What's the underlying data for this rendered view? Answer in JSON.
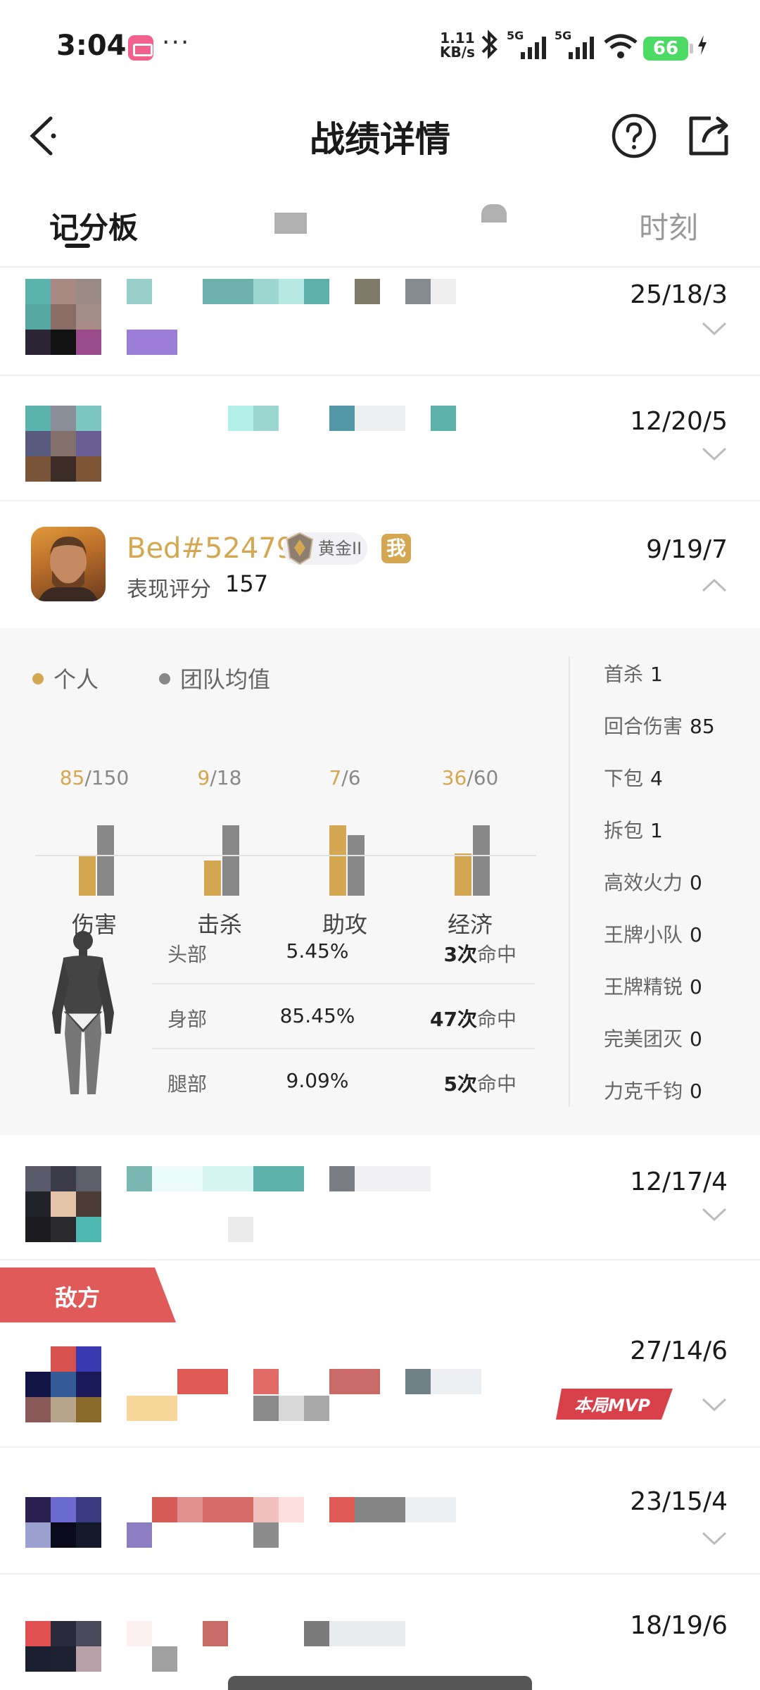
{
  "status_bar": {
    "time": "3:04",
    "network_speed": "1.11",
    "network_unit": "KB/s",
    "signal_1": "5G",
    "signal_2": "5G",
    "battery": "66",
    "more": "···"
  },
  "header": {
    "title": "战绩详情",
    "back_icon": "back-arrow-icon",
    "help_icon": "question-circle-icon",
    "share_icon": "share-icon"
  },
  "tabs": {
    "items": [
      {
        "label": "记分板",
        "active": true
      },
      {
        "label": "",
        "active": false
      },
      {
        "label": "",
        "active": false
      },
      {
        "label": "时刻",
        "active": false
      }
    ]
  },
  "rows_top": [
    {
      "kda": "25/18/3"
    },
    {
      "kda": "12/20/5"
    }
  ],
  "player": {
    "name": "Bed#52479",
    "rank": "黄金II",
    "me_badge": "我",
    "score_label": "表现评分",
    "score": "157",
    "kda": "9/19/7"
  },
  "detail": {
    "legend_personal": "个人",
    "legend_team": "团队均值",
    "personal_color": "#d4a853",
    "team_color": "#888888",
    "chart_data": {
      "type": "bar",
      "categories": [
        "伤害",
        "击杀",
        "助攻",
        "经济"
      ],
      "series": [
        {
          "name": "个人",
          "values": [
            85,
            9,
            7,
            36
          ]
        },
        {
          "name": "团队均值",
          "values": [
            150,
            18,
            6,
            60
          ]
        }
      ]
    },
    "value_labels": [
      {
        "personal": "85",
        "team": "/150"
      },
      {
        "personal": "9",
        "team": "/18"
      },
      {
        "personal": "7",
        "team": "/6"
      },
      {
        "personal": "36",
        "team": "/60"
      }
    ],
    "hits": [
      {
        "part": "头部",
        "pct": "5.45%",
        "count": "3次",
        "suffix": "命中"
      },
      {
        "part": "身部",
        "pct": "85.45%",
        "count": "47次",
        "suffix": "命中"
      },
      {
        "part": "腿部",
        "pct": "9.09%",
        "count": "5次",
        "suffix": "命中"
      }
    ],
    "stats": [
      {
        "label": "首杀",
        "value": "1"
      },
      {
        "label": "回合伤害",
        "value": "85"
      },
      {
        "label": "下包",
        "value": "4"
      },
      {
        "label": "拆包",
        "value": "1"
      },
      {
        "label": "高效火力",
        "value": "0"
      },
      {
        "label": "王牌小队",
        "value": "0"
      },
      {
        "label": "王牌精锐",
        "value": "0"
      },
      {
        "label": "完美团灭",
        "value": "0"
      },
      {
        "label": "力克千钧",
        "value": "0"
      }
    ]
  },
  "row_after": {
    "kda": "12/17/4"
  },
  "enemy_label": "敌方",
  "mvp_label": "本局MVP",
  "rows_enemy": [
    {
      "kda": "27/14/6"
    },
    {
      "kda": "23/15/4"
    },
    {
      "kda": "18/19/6"
    }
  ]
}
